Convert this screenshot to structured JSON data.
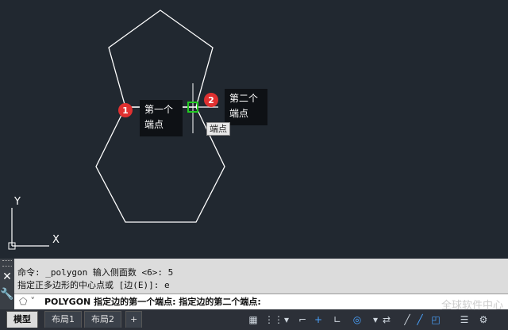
{
  "markers": {
    "first": "1",
    "second": "2"
  },
  "callouts": {
    "first": [
      "第一个",
      "端点"
    ],
    "second": [
      "第二个",
      "端点"
    ]
  },
  "tooltip": "端点",
  "ucs": {
    "y_label": "Y",
    "x_label": "X"
  },
  "command_history": [
    "命令: _polygon 输入侧面数 <6>: 5",
    "指定正多边形的中心点或 [边(E)]: e"
  ],
  "command_prompt": "POLYGON 指定边的第一个端点: 指定边的第二个端点:",
  "tabs": [
    "模型",
    "布局1",
    "布局2"
  ],
  "tab_add": "+",
  "watermark": "全球软件中心",
  "colors": {
    "canvas": "#212830",
    "marker": "#e03030",
    "geometry": "#ffffff",
    "snap": "#22cc22"
  }
}
